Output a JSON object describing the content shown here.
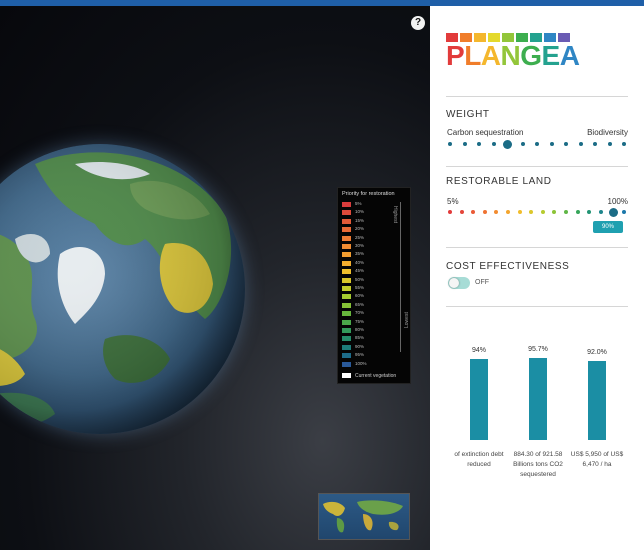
{
  "help_button": "?",
  "legend": {
    "title": "Priority for restoration",
    "high_label": "Highest",
    "low_label": "Lowest",
    "items": [
      {
        "label": "5%",
        "color": "#d83c3c"
      },
      {
        "label": "10%",
        "color": "#de4a3a"
      },
      {
        "label": "15%",
        "color": "#e35a38"
      },
      {
        "label": "20%",
        "color": "#e86a36"
      },
      {
        "label": "25%",
        "color": "#ec7b34"
      },
      {
        "label": "30%",
        "color": "#f08c32"
      },
      {
        "label": "35%",
        "color": "#f29d30"
      },
      {
        "label": "40%",
        "color": "#f4ae2e"
      },
      {
        "label": "45%",
        "color": "#efbf2c"
      },
      {
        "label": "50%",
        "color": "#d9c62a"
      },
      {
        "label": "55%",
        "color": "#c2cc2a"
      },
      {
        "label": "60%",
        "color": "#a6cc30"
      },
      {
        "label": "65%",
        "color": "#86c236"
      },
      {
        "label": "70%",
        "color": "#67b63c"
      },
      {
        "label": "75%",
        "color": "#4aa84a"
      },
      {
        "label": "80%",
        "color": "#339a5a"
      },
      {
        "label": "85%",
        "color": "#258c6a"
      },
      {
        "label": "90%",
        "color": "#1d7c7a"
      },
      {
        "label": "95%",
        "color": "#1d6c8a"
      },
      {
        "label": "100%",
        "color": "#2a5a9a"
      }
    ],
    "current_vegetation": "Current vegetation"
  },
  "sidebar": {
    "logo_text": "PLANGEA",
    "logo_colors": [
      "#e23b3b",
      "#f07d2a",
      "#f4b72d",
      "#e4d92c",
      "#93c63a",
      "#3dae4f",
      "#24a28f",
      "#2f86c4",
      "#6a5bb3"
    ],
    "weight": {
      "title": "WEIGHT",
      "left_label": "Carbon sequestration",
      "right_label": "Biodiversity",
      "value": 0.33
    },
    "restorable": {
      "title": "RESTORABLE LAND",
      "min_label": "5%",
      "max_label": "100%",
      "value": 0.94,
      "badge": "90%"
    },
    "cost": {
      "title": "COST EFFECTIVENESS",
      "toggle_label": "OFF",
      "toggle_on": false
    },
    "bars": [
      {
        "pct": "94%",
        "value": 94,
        "label": "of extinction debt reduced"
      },
      {
        "pct": "95.7%",
        "value": 95.7,
        "label": "884.30 of 921.58 Billions tons CO2 sequestered"
      },
      {
        "pct": "92.0%",
        "value": 92.0,
        "label": "US$ 5,950 of US$ 6,470 / ha"
      }
    ],
    "bar_color": "#1b8ea4"
  }
}
